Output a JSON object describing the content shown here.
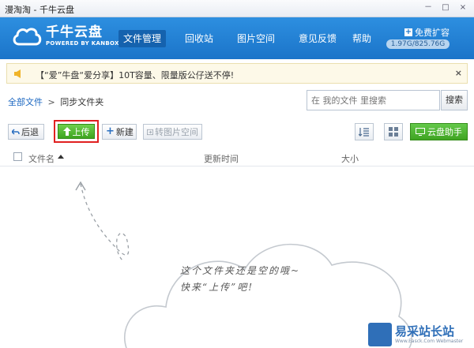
{
  "window": {
    "title": "漫淘淘 - 千牛云盘",
    "controls": [
      "－",
      "□",
      "×"
    ]
  },
  "header": {
    "logo_title": "千牛云盘",
    "logo_sub": "POWERED BY KANBOX",
    "nav": [
      "文件管理",
      "回收站",
      "图片空间",
      "意见反馈"
    ],
    "help": "帮助",
    "expand": "免费扩容",
    "quota": "1.97G/825.76G"
  },
  "notice": {
    "text": "【“爱”牛盘“爱分享】10T容量、限量版公仔送不停!",
    "close": "×"
  },
  "breadcrumb": {
    "root": "全部文件",
    "sep": ">",
    "current": "同步文件夹"
  },
  "search": {
    "placeholder": "在 我的文件 里搜索",
    "button": "搜索"
  },
  "toolbar": {
    "back": "后退",
    "upload": "上传",
    "new": "新建",
    "to_image_space": "转图片空间",
    "assistant": "云盘助手"
  },
  "list": {
    "col_name": "文件名",
    "col_time": "更新时间",
    "col_size": "大小"
  },
  "empty": {
    "line1": "这个文件夹还是空的哦~",
    "line2": "快来“上传”吧!"
  },
  "watermark": {
    "title": "易采站长站",
    "sub": "Www.Easck.Com Webmaster"
  },
  "colors": {
    "header_blue": "#1b74c9",
    "active_nav": "#1562ae",
    "green": "#3fa322",
    "highlight_red": "#e02020"
  }
}
